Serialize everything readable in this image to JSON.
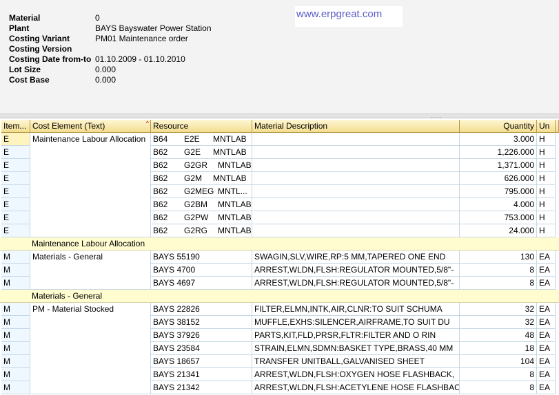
{
  "header": {
    "watermark": "www.erpgreat.com",
    "fields": [
      {
        "label": "Material",
        "value": "0"
      },
      {
        "label": "Plant",
        "value": "BAYS Bayswater Power Station"
      },
      {
        "label": "Costing Variant",
        "value": "PM01 Maintenance order"
      },
      {
        "label": "Costing Version",
        "value": ""
      },
      {
        "label": "Costing Date from-to",
        "value": "01.10.2009 - 01.10.2010"
      },
      {
        "label": "Lot Size",
        "value": "0.000"
      },
      {
        "label": "Cost Base",
        "value": "0.000"
      }
    ]
  },
  "splitter": {
    "grip": "....."
  },
  "table": {
    "columns": {
      "item": "Item...",
      "cost_element": "Cost Element (Text)",
      "resource": "Resource",
      "description": "Material Description",
      "quantity": "Quantity",
      "unit": "Un"
    },
    "groups": [
      {
        "cost_element": "Maintenance Labour Allocation",
        "subtotal": "Maintenance Labour Allocation",
        "rows": [
          {
            "item": "E",
            "resource": [
              "B64",
              "E2E",
              "MNTLAB"
            ],
            "description": "",
            "quantity": "3.000",
            "unit": "H"
          },
          {
            "item": "E",
            "resource": [
              "B62",
              "G2E",
              "MNTLAB"
            ],
            "description": "",
            "quantity": "1,226.000",
            "unit": "H"
          },
          {
            "item": "E",
            "resource": [
              "B62",
              "G2GR",
              "MNTLAB"
            ],
            "description": "",
            "quantity": "1,371.000",
            "unit": "H"
          },
          {
            "item": "E",
            "resource": [
              "B62",
              "G2M",
              "MNTLAB"
            ],
            "description": "",
            "quantity": "626.000",
            "unit": "H"
          },
          {
            "item": "E",
            "resource": [
              "B62",
              "G2MEG",
              "MNTL..."
            ],
            "description": "",
            "quantity": "795.000",
            "unit": "H"
          },
          {
            "item": "E",
            "resource": [
              "B62",
              "G2BM",
              "MNTLAB"
            ],
            "description": "",
            "quantity": "4.000",
            "unit": "H"
          },
          {
            "item": "E",
            "resource": [
              "B62",
              "G2PW",
              "MNTLAB"
            ],
            "description": "",
            "quantity": "753.000",
            "unit": "H"
          },
          {
            "item": "E",
            "resource": [
              "B62",
              "G2RG",
              "MNTLAB"
            ],
            "description": "",
            "quantity": "24.000",
            "unit": "H"
          }
        ]
      },
      {
        "cost_element": "Materials - General",
        "subtotal": "Materials - General",
        "rows": [
          {
            "item": "M",
            "resource": [
              "BAYS 55190"
            ],
            "description": "SWAGIN,SLV,WIRE,RP:5 MM,TAPERED ONE END",
            "quantity": "130",
            "unit": "EA"
          },
          {
            "item": "M",
            "resource": [
              "BAYS 4700"
            ],
            "description": "ARREST,WLDN,FLSH:REGULATOR MOUNTED,5/8\"-",
            "quantity": "8",
            "unit": "EA"
          },
          {
            "item": "M",
            "resource": [
              "BAYS 4697"
            ],
            "description": "ARREST,WLDN,FLSH:REGULATOR MOUNTED,5/8\"-",
            "quantity": "8",
            "unit": "EA"
          }
        ]
      },
      {
        "cost_element": "PM - Material Stocked",
        "subtotal": "",
        "rows": [
          {
            "item": "M",
            "resource": [
              "BAYS 22826"
            ],
            "description": "FILTER,ELMN,INTK,AIR,CLNR:TO SUIT SCHUMA",
            "quantity": "32",
            "unit": "EA"
          },
          {
            "item": "M",
            "resource": [
              "BAYS 38152"
            ],
            "description": "MUFFLE,EXHS:SILENCER,AIRFRAME,TO SUIT DU",
            "quantity": "32",
            "unit": "EA"
          },
          {
            "item": "M",
            "resource": [
              "BAYS 37926"
            ],
            "description": "PARTS,KIT,FLD,PRSR,FLTR:FILTER AND O RIN",
            "quantity": "48",
            "unit": "EA"
          },
          {
            "item": "M",
            "resource": [
              "BAYS 23584"
            ],
            "description": "STRAIN,ELMN,SDMN:BASKET TYPE,BRASS,40 MM",
            "quantity": "18",
            "unit": "EA"
          },
          {
            "item": "M",
            "resource": [
              "BAYS 18657"
            ],
            "description": "TRANSFER UNITBALL,GALVANISED SHEET",
            "quantity": "104",
            "unit": "EA"
          },
          {
            "item": "M",
            "resource": [
              "BAYS 21341"
            ],
            "description": "ARREST,WLDN,FLSH:OXYGEN HOSE FLASHBACK,",
            "quantity": "8",
            "unit": "EA"
          },
          {
            "item": "M",
            "resource": [
              "BAYS 21342"
            ],
            "description": "ARREST,WLDN,FLSH:ACETYLENE HOSE FLASHBAC",
            "quantity": "8",
            "unit": "EA"
          }
        ]
      }
    ]
  }
}
